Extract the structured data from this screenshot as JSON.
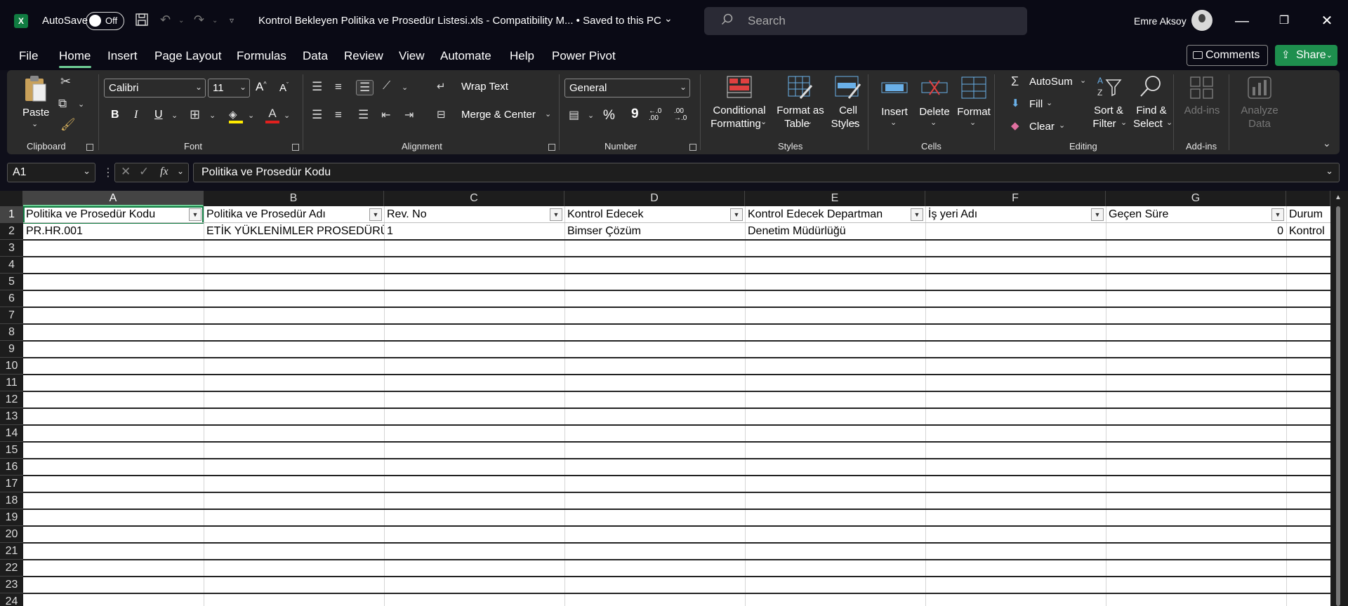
{
  "titlebar": {
    "app_logo": "X",
    "autosave_label": "AutoSave",
    "autosave_state": "Off",
    "document_title": "Kontrol Bekleyen Politika ve Prosedür Listesi.xls  -  Compatibility M...  •  Saved to this PC",
    "search_placeholder": "Search",
    "user_name": "Emre Aksoy",
    "minimize": "—",
    "restore": "❐",
    "close": "✕"
  },
  "menu": {
    "items": [
      "File",
      "Home",
      "Insert",
      "Page Layout",
      "Formulas",
      "Data",
      "Review",
      "View",
      "Automate",
      "Help",
      "Power Pivot"
    ],
    "active": "Home",
    "comments_label": "Comments",
    "share_label": "Share"
  },
  "ribbon": {
    "clipboard": {
      "label": "Clipboard",
      "paste": "Paste"
    },
    "font": {
      "label": "Font",
      "name": "Calibri",
      "size": "11",
      "bold": "B",
      "italic": "I",
      "underline": "U"
    },
    "alignment": {
      "label": "Alignment",
      "wrap_text": "Wrap Text",
      "merge_center": "Merge & Center"
    },
    "number": {
      "label": "Number",
      "format": "General",
      "percent": "%",
      "comma": "9",
      "inc_decimal": "←.0 .00",
      "dec_decimal": ".00 →.0"
    },
    "styles": {
      "label": "Styles",
      "conditional_1": "Conditional",
      "conditional_2": "Formatting",
      "format_table_1": "Format as",
      "format_table_2": "Table",
      "cell_styles_1": "Cell",
      "cell_styles_2": "Styles"
    },
    "cells": {
      "label": "Cells",
      "insert": "Insert",
      "delete": "Delete",
      "format": "Format"
    },
    "editing": {
      "label": "Editing",
      "autosum": "AutoSum",
      "fill": "Fill",
      "clear": "Clear",
      "sort_1": "Sort &",
      "sort_2": "Filter",
      "find_1": "Find &",
      "find_2": "Select"
    },
    "addins": {
      "label": "Add-ins",
      "addins": "Add-ins",
      "analyze_1": "Analyze",
      "analyze_2": "Data"
    }
  },
  "formula_bar": {
    "name_box": "A1",
    "fx": "fx",
    "formula": "Politika ve Prosedür Kodu"
  },
  "sheet": {
    "columns": [
      "A",
      "B",
      "C",
      "D",
      "E",
      "F",
      "G",
      ""
    ],
    "rows": [
      "1",
      "2",
      "3",
      "4",
      "5",
      "6",
      "7",
      "8",
      "9",
      "10",
      "11",
      "12",
      "13",
      "14",
      "15",
      "16",
      "17",
      "18",
      "19",
      "20",
      "21",
      "22",
      "23",
      "24"
    ],
    "header_row": [
      "Politika ve Prosedür Kodu",
      "Politika ve Prosedür Adı",
      "Rev. No",
      "Kontrol Edecek",
      "Kontrol Edecek Departman",
      "İş yeri Adı",
      "Geçen Süre",
      "Durum"
    ],
    "data_row": [
      "PR.HR.001",
      "ETİK YÜKLENİMLER PROSEDÜRÜ",
      "1",
      "Bimser Çözüm",
      "Denetim Müdürlüğü",
      "",
      "0",
      "Kontrol"
    ]
  }
}
